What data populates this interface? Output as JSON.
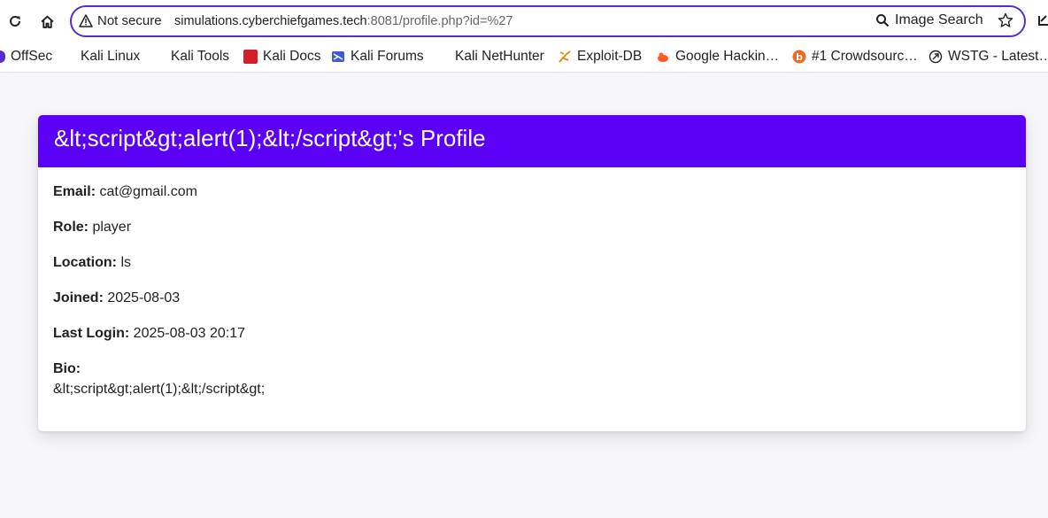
{
  "browser": {
    "security_label": "Not secure",
    "url_host": "simulations.cyberchiefgames.tech",
    "url_rest": ":8081/profile.php?id=%27",
    "image_search_label": "Image Search",
    "bookmarks": [
      {
        "label": "OffSec"
      },
      {
        "label": "Kali Linux"
      },
      {
        "label": "Kali Tools"
      },
      {
        "label": "Kali Docs"
      },
      {
        "label": "Kali Forums"
      },
      {
        "label": "Kali NetHunter"
      },
      {
        "label": "Exploit-DB"
      },
      {
        "label": "Google Hackin…"
      },
      {
        "label": "#1 Crowdsourc…"
      },
      {
        "label": "WSTG - Latest…"
      }
    ]
  },
  "profile": {
    "title": "&lt;script&gt;alert(1);&lt;/script&gt;'s Profile",
    "accent_color": "#5b00f7",
    "fields": [
      {
        "label": "Email:",
        "value": "cat@gmail.com"
      },
      {
        "label": "Role:",
        "value": "player"
      },
      {
        "label": "Location:",
        "value": "ls"
      },
      {
        "label": "Joined:",
        "value": "2025-08-03"
      },
      {
        "label": "Last Login:",
        "value": "2025-08-03 20:17"
      }
    ],
    "bio_label": "Bio:",
    "bio_text": "&lt;script&gt;alert(1);&lt;/script&gt;"
  }
}
